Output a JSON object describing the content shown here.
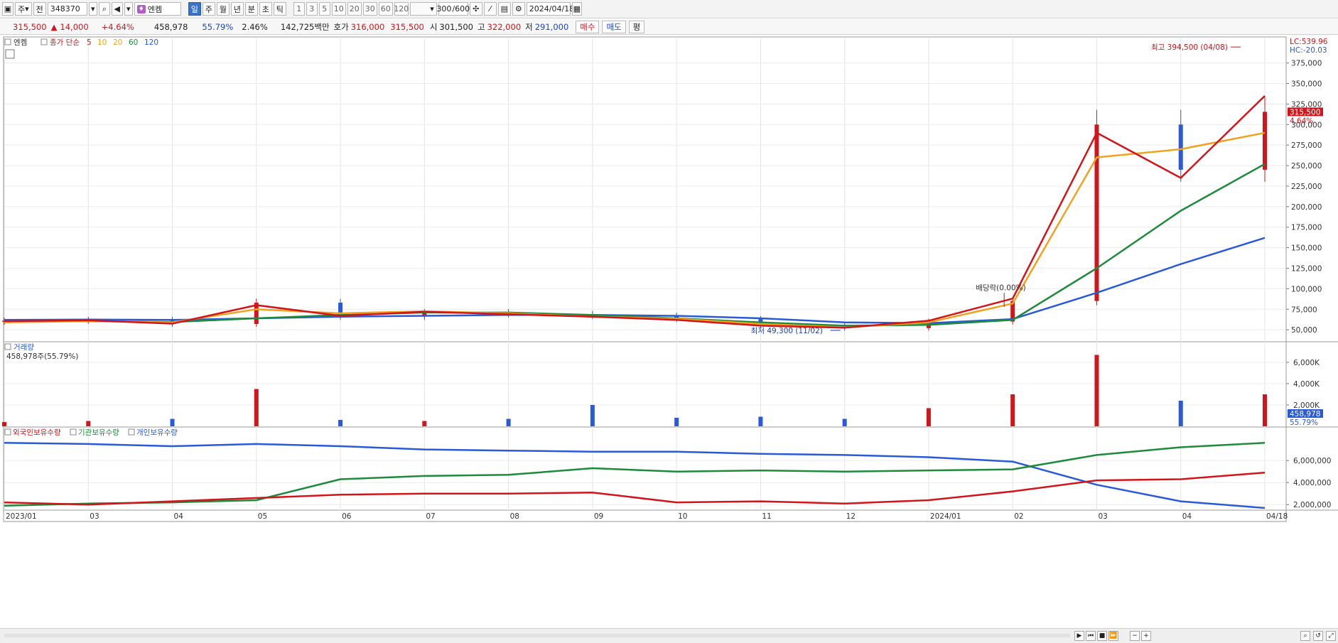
{
  "toolbar": {
    "type_select": "주",
    "jeon_label": "전",
    "code": "348370",
    "stock_name": "엔켐",
    "periods": [
      "일",
      "주",
      "월",
      "년",
      "분",
      "초",
      "틱"
    ],
    "period_selected": "일",
    "intervals": [
      "1",
      "3",
      "5",
      "10",
      "20",
      "30",
      "60",
      "120"
    ],
    "count": "300",
    "count_total": "/600",
    "date": "2024/04/18"
  },
  "quote": {
    "price": "315,500",
    "change": "14,000",
    "change_pct": "+4.64%",
    "volume": "458,978",
    "vol_ratio": "55.79%",
    "turnover": "2.46%",
    "amount": "142,725백만",
    "ask_label": "호가",
    "ask": "316,000",
    "bid": "315,500",
    "open_label": "시",
    "open": "301,500",
    "high_label": "고",
    "high": "322,000",
    "low_label": "저",
    "low": "291,000",
    "buy_label": "매수",
    "sell_label": "매도",
    "eval_label": "평"
  },
  "chart_data": [
    {
      "type": "line",
      "panel": "price",
      "title": "엔켐",
      "legend": [
        "종가 단순",
        "5",
        "10",
        "20",
        "60",
        "120"
      ],
      "legend_colors": [
        "#d0161b",
        "#d0161b",
        "#f0a21e",
        "#f0a21e",
        "#1d8a3c",
        "#2a5ad8"
      ],
      "x_tick_labels": [
        "2023/01",
        "03",
        "04",
        "05",
        "06",
        "07",
        "08",
        "09",
        "10",
        "11",
        "12",
        "2024/01",
        "02",
        "03",
        "04",
        "04/18"
      ],
      "y_ticks": [
        50000,
        75000,
        100000,
        125000,
        150000,
        175000,
        200000,
        225000,
        250000,
        275000,
        300000,
        325000,
        350000,
        375000
      ],
      "y_tick_labels": [
        "50,000",
        "75,000",
        "100,000",
        "125,000",
        "150,000",
        "175,000",
        "200,000",
        "225,000",
        "250,000",
        "275,000",
        "300,000",
        "325,000",
        "350,000",
        "375,000"
      ],
      "ylim": [
        38000,
        405000
      ],
      "lc_label": "LC:539.96",
      "hc_label": "HC:-20.03",
      "current_price_label": "315,500",
      "current_pct_label": "4.64%",
      "annotations": {
        "high": "최고 394,500 (04/08)",
        "low": "최저 49,300 (11/02)",
        "dividend": "배당락(0.00%)"
      },
      "months": [
        "2023/01",
        "2023/02",
        "2023/03",
        "2023/04",
        "2023/05",
        "2023/06",
        "2023/07",
        "2023/08",
        "2023/09",
        "2023/10",
        "2023/11",
        "2023/12",
        "2024/01",
        "2024/02",
        "2024/03",
        "2024/04"
      ],
      "close": [
        61000,
        62000,
        57000,
        83000,
        66000,
        71000,
        69000,
        67000,
        63000,
        56000,
        52000,
        60000,
        85000,
        300000,
        245000,
        315500
      ],
      "ma5": [
        60500,
        61500,
        57500,
        80000,
        67000,
        72000,
        69000,
        66000,
        62000,
        55000,
        52500,
        61000,
        88000,
        290000,
        235000,
        335000
      ],
      "ma20": [
        59000,
        60500,
        59000,
        75000,
        70000,
        72500,
        70000,
        66000,
        63500,
        57000,
        53000,
        59000,
        82000,
        260000,
        270000,
        290000
      ],
      "ma60": [
        60000,
        60500,
        59500,
        64000,
        68000,
        71000,
        71000,
        68000,
        64000,
        59000,
        55000,
        56000,
        62000,
        125000,
        195000,
        252000
      ],
      "ma120": [
        62000,
        62500,
        62000,
        64000,
        66000,
        67000,
        68000,
        68000,
        67000,
        64000,
        59000,
        58000,
        63000,
        95000,
        130000,
        162000
      ]
    },
    {
      "type": "bar",
      "panel": "volume",
      "title": "거래량",
      "current_label": "458,978주(55.79%)",
      "y_tick_labels": [
        "2,000K",
        "4,000K",
        "6,000K"
      ],
      "ylim": [
        0,
        7000000
      ],
      "months": [
        "2023/01",
        "2023/02",
        "2023/03",
        "2023/04",
        "2023/05",
        "2023/06",
        "2023/07",
        "2023/08",
        "2023/09",
        "2023/10",
        "2023/11",
        "2023/12",
        "2024/01",
        "2024/02",
        "2024/03",
        "2024/04"
      ],
      "peak_values": [
        400000,
        500000,
        700000,
        3500000,
        600000,
        500000,
        700000,
        2000000,
        800000,
        900000,
        700000,
        1700000,
        3000000,
        6700000,
        2400000,
        3000000
      ],
      "current_value_label": "458,978",
      "current_pct_label": "55.79%"
    },
    {
      "type": "line",
      "panel": "ownership",
      "legend": [
        "외국인보유수량",
        "기관보유수량",
        "개인보유수량"
      ],
      "legend_colors": [
        "#d0161b",
        "#1d8a3c",
        "#2a5ad8"
      ],
      "y_tick_labels": [
        "2,000,000",
        "4,000,000",
        "6,000,000"
      ],
      "ylim": [
        1500000,
        8200000
      ],
      "months": [
        "2023/01",
        "2023/02",
        "2023/03",
        "2023/04",
        "2023/05",
        "2023/06",
        "2023/07",
        "2023/08",
        "2023/09",
        "2023/10",
        "2023/11",
        "2023/12",
        "2024/01",
        "2024/02",
        "2024/03",
        "2024/04"
      ],
      "foreign": [
        2200000,
        2000000,
        2300000,
        2600000,
        2900000,
        3000000,
        3000000,
        3100000,
        2200000,
        2300000,
        2100000,
        2400000,
        3200000,
        4200000,
        4300000,
        4900000
      ],
      "institution": [
        1900000,
        2100000,
        2200000,
        2400000,
        4300000,
        4600000,
        4700000,
        5300000,
        5000000,
        5100000,
        5000000,
        5100000,
        5200000,
        6500000,
        7200000,
        7600000
      ],
      "individual": [
        7600000,
        7500000,
        7300000,
        7500000,
        7300000,
        7000000,
        6900000,
        6800000,
        6800000,
        6600000,
        6500000,
        6300000,
        5900000,
        3800000,
        2300000,
        1700000
      ]
    }
  ],
  "status": {
    "buttons": [
      "▶",
      "⏮",
      "⏪",
      "■",
      "⏩",
      "+"
    ]
  }
}
